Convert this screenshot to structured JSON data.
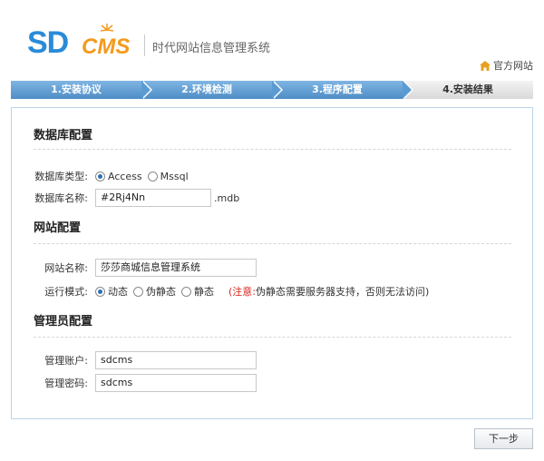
{
  "header": {
    "logo_text_sd": "SD",
    "logo_text_cms": "CMS",
    "tagline": "时代网站信息管理系统",
    "home_link": "官方网站",
    "home_icon": "home-icon"
  },
  "steps": [
    {
      "label": "1.安装协议",
      "state": "done"
    },
    {
      "label": "2.环境检测",
      "state": "done"
    },
    {
      "label": "3.程序配置",
      "state": "done"
    },
    {
      "label": "4.安装结果",
      "state": "current"
    }
  ],
  "database": {
    "title": "数据库配置",
    "type_label": "数据库类型:",
    "type_options": [
      "Access",
      "Mssql"
    ],
    "type_selected": "Access",
    "name_label": "数据库名称:",
    "name_value": "#2Rj4Nn",
    "name_suffix": ".mdb"
  },
  "site": {
    "title": "网站配置",
    "name_label": "网站名称:",
    "name_value": "莎莎商城信息管理系统",
    "mode_label": "运行模式:",
    "mode_options": [
      "动态",
      "伪静态",
      "静态"
    ],
    "mode_selected": "动态",
    "note_warn": "(注意:",
    "note_text": "伪静态需要服务器支持，否则无法访问)"
  },
  "admin": {
    "title": "管理员配置",
    "account_label": "管理账户:",
    "account_value": "sdcms",
    "password_label": "管理密码:",
    "password_value": "sdcms"
  },
  "footer": {
    "next_label": "下一步"
  },
  "colors": {
    "step_done": "#5b9bd3",
    "step_current": "#e3e3e3",
    "panel_border": "#bcd4ea",
    "warn": "#d9261c"
  }
}
